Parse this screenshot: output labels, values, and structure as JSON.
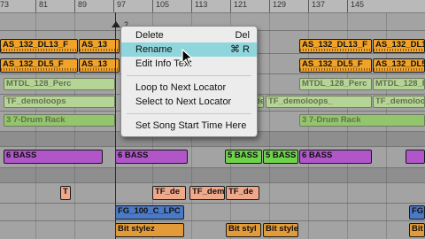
{
  "ruler": {
    "bars": [
      "73",
      "81",
      "89",
      "97",
      "105",
      "113",
      "121",
      "129",
      "137",
      "145"
    ]
  },
  "marker": {
    "label": "2"
  },
  "clips": {
    "as_dl13": "AS_132_DL13_F",
    "as_dl13_b": "AS_13",
    "as_dl13_c": "AS_132_DL13_F",
    "as_dl13_d": "AS_132_DL13_F",
    "as_dl5": "AS_132_DL5_F",
    "as_dl5_c": "AS_132_DL5_F",
    "as_dl5_d": "AS_132_DL5_F",
    "mtdl": "MTDL_128_Perc",
    "mtdl_b": "MTDL_128_Perc",
    "tf_demo": "TF_demoloops",
    "tf_demo_b": "TF_de",
    "tf_demo_c": "TF_demoloops_",
    "drum_rack": "3 7-Drum Rack",
    "drum_rack_b": "3 7-Drum Rack",
    "bass": "6 BASS",
    "bass_b": "6 BASS",
    "bass_5a": "5 BASS",
    "bass_5b": "5 BASS",
    "tf_t": "T",
    "tf_1": "TF_de",
    "tf_2": "TF_dem",
    "tf_3": "TF_de",
    "fg": "FG_100_C_LPC",
    "fg_b": "FG_",
    "bit_1": "Bit stylez",
    "bit_2": "Bit styl",
    "bit_3": "Bit stylez",
    "bit_4": "Bit s"
  },
  "context_menu": {
    "delete": "Delete",
    "delete_shortcut": "Del",
    "rename": "Rename",
    "rename_shortcut": "⌘ R",
    "edit_info": "Edit Info Text",
    "loop_next": "Loop to Next Locator",
    "select_next": "Select to Next Locator",
    "set_start": "Set Song Start Time Here"
  },
  "colors": {
    "orange": "#f0a229",
    "green_light": "#b4d596",
    "green_drum": "#92c56c",
    "purple": "#b056c8",
    "green_bass": "#6ed24a",
    "salmon": "#f0a88a",
    "blue": "#4a79c6",
    "bit_orange": "#e39a38",
    "highlight": "#8ed6dc"
  }
}
